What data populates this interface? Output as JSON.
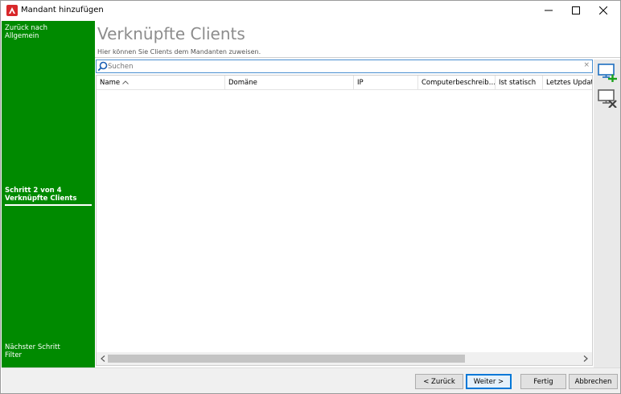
{
  "window": {
    "title": "Mandant hinzufügen",
    "app_icon": "app-logo-icon",
    "controls": [
      "minimize-icon",
      "maximize-icon",
      "close-icon"
    ]
  },
  "sidebar": {
    "back_line1": "Zurück nach",
    "back_line2": "Allgemein",
    "step_line1": "Schritt 2 von 4",
    "step_line2": "Verknüpfte Clients",
    "next_line1": "Nächster Schritt",
    "next_line2": "Filter",
    "background_color": "#008a00"
  },
  "main": {
    "title": "Verknüpfte Clients",
    "subtitle": "Hier können Sie Clients dem Mandanten zuweisen.",
    "search": {
      "placeholder": "Suchen",
      "value": "",
      "clear_label": "×"
    },
    "grid": {
      "columns": [
        "Name",
        "Domäne",
        "IP",
        "Computerbeschreib…",
        "Ist statisch",
        "Letztes Update"
      ],
      "sorted_column": "Name",
      "sort_direction": "ascending",
      "rows": [],
      "scroll_left_label": "<",
      "scroll_right_label": ">"
    },
    "tools": {
      "add_icon": "monitor-add-icon",
      "remove_icon": "monitor-remove-icon"
    }
  },
  "footer": {
    "back_label": "< Zurück",
    "next_label": "Weiter >",
    "finish_label": "Fertig",
    "cancel_label": "Abbrechen"
  },
  "colors": {
    "accent": "#0078d7",
    "sidebar_green": "#008a00",
    "title_gray": "#8c8c8c"
  }
}
